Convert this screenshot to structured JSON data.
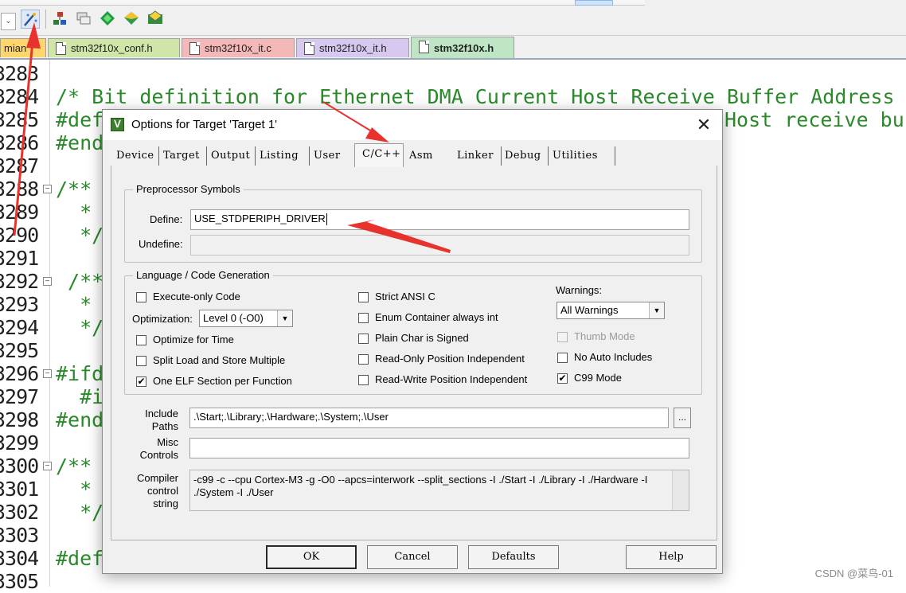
{
  "editor": {
    "tabs": [
      {
        "label": "mian",
        "color": "#ffd66b"
      },
      {
        "label": "stm32f10x_conf.h",
        "color": "#cfe6a8"
      },
      {
        "label": "stm32f10x_it.c",
        "color": "#f4b8b8"
      },
      {
        "label": "stm32f10x_it.h",
        "color": "#d6c8ee"
      },
      {
        "label": "stm32f10x.h",
        "color": "#bfe6c4",
        "active": true
      }
    ],
    "line_numbers": [
      "3283",
      "3284",
      "3285",
      "3286",
      "3287",
      "3288",
      "3289",
      "3290",
      "3291",
      "3292",
      "3293",
      "3294",
      "3295",
      "3296",
      "3297",
      "3298",
      "3299",
      "3300",
      "3301",
      "3302",
      "3303",
      "3304",
      "3305"
    ],
    "code_lines": [
      "",
      "/* Bit definition for Ethernet DMA Current Host Receive Buffer Address R",
      "#def",
      "#end",
      "",
      "/**",
      "  *",
      "  */",
      "",
      " /**",
      "  *",
      "  */",
      "",
      "#ifd",
      "  #i",
      "#end",
      "",
      "/**",
      "  *",
      "  */",
      "",
      "#def",
      ""
    ],
    "line2_tail": "Host receive buf"
  },
  "dialog": {
    "title": "Options for Target 'Target 1'",
    "close_label": "✕",
    "app_icon": "Ⅴ",
    "tabs": [
      "Device",
      "Target",
      "Output",
      "Listing",
      "User",
      "C/C++",
      "Asm",
      "Linker",
      "Debug",
      "Utilities"
    ],
    "active_tab": "C/C++",
    "preprocessor": {
      "group_label": "Preprocessor Symbols",
      "define_label": "Define:",
      "define_value": "USE_STDPERIPH_DRIVER",
      "undefine_label": "Undefine:",
      "undefine_value": ""
    },
    "language": {
      "group_label": "Language / Code Generation",
      "execute_only": {
        "label": "Execute-only Code",
        "checked": false
      },
      "optimization_label": "Optimization:",
      "optimization_value": "Level 0 (-O0)",
      "optimize_time": {
        "label": "Optimize for Time",
        "checked": false
      },
      "split_load": {
        "label": "Split Load and Store Multiple",
        "checked": false
      },
      "one_elf": {
        "label": "One ELF Section per Function",
        "checked": true
      },
      "strict_ansi": {
        "label": "Strict ANSI C",
        "checked": false
      },
      "enum_container": {
        "label": "Enum Container always int",
        "checked": false
      },
      "plain_char": {
        "label": "Plain Char is Signed",
        "checked": false
      },
      "ropi": {
        "label": "Read-Only Position Independent",
        "checked": false
      },
      "rwpi": {
        "label": "Read-Write Position Independent",
        "checked": false
      },
      "warnings_label": "Warnings:",
      "warnings_value": "All Warnings",
      "thumb_mode": {
        "label": "Thumb Mode",
        "checked": false,
        "disabled": true
      },
      "no_auto_includes": {
        "label": "No Auto Includes",
        "checked": false
      },
      "c99_mode": {
        "label": "C99 Mode",
        "checked": true
      }
    },
    "include_paths": {
      "label_1": "Include",
      "label_2": "Paths",
      "value": ".\\Start;.\\Library;.\\Hardware;.\\System;.\\User",
      "browse_label": "..."
    },
    "misc_controls": {
      "label_1": "Misc",
      "label_2": "Controls",
      "value": ""
    },
    "compiler_string": {
      "label_1": "Compiler",
      "label_2": "control",
      "label_3": "string",
      "value": "-c99 -c --cpu Cortex-M3 -g -O0 --apcs=interwork --split_sections -I ./Start -I ./Library -I ./Hardware -I ./System -I ./User"
    },
    "buttons": {
      "ok": "OK",
      "cancel": "Cancel",
      "defaults": "Defaults",
      "help": "Help"
    }
  },
  "watermark": "CSDN @菜鸟-01",
  "colors": {
    "annotation_arrow": "#e8322d",
    "code_green": "#2a8a2a"
  }
}
